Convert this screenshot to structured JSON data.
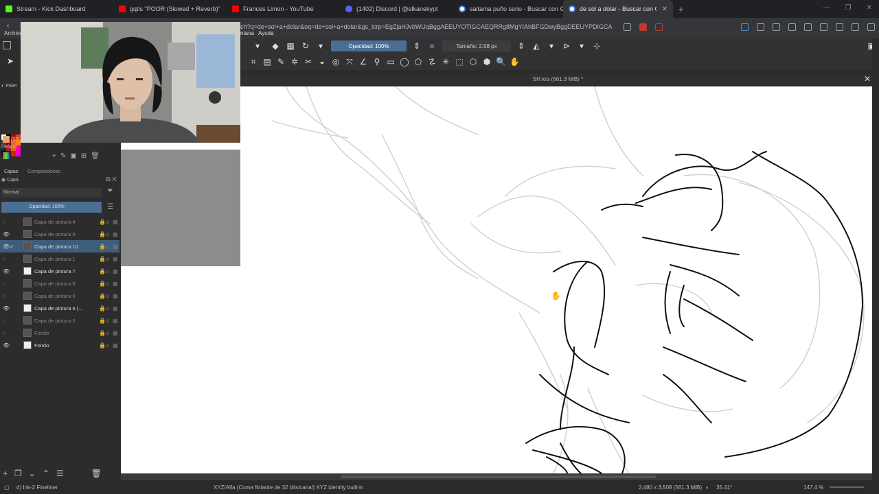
{
  "browser": {
    "tabs": [
      {
        "title": "Stream - Kick Dashboard",
        "color": "#53fc18"
      },
      {
        "title": "gqtis \"POOR (Slowed + Reverb)\"",
        "color": "#ff0000"
      },
      {
        "title": "Frances Limon - YouTube",
        "color": "#ff0000"
      },
      {
        "title": "(1402) Discord | @elkanekypt",
        "color": "#5865f2"
      },
      {
        "title": "saitama puño serio - Buscar con Goo",
        "color": "#4285f4"
      },
      {
        "title": "de sol a dolar - Buscar con Goog",
        "color": "#4285f4"
      }
    ],
    "new_tab": "+",
    "url": "ch?q=de+sol+a+dolar&oq=de+sol+a+dolar&gs_lcrp=EgZjaHJvbWUqBggAEEUYOTIGCAEQRRg8MgYIAhBFGDwyBggDEEUYPDIGCA",
    "back": "‹"
  },
  "krita": {
    "menu": [
      "ntana",
      "Ayuda"
    ],
    "left_menu_text": "Archivo",
    "opacity_label": "Opacidad: 100%",
    "size_label": "Tamaño: 2.58 px",
    "document_title": "SH.kra (561.3 MiB) *",
    "close": "✕"
  },
  "left_panel": {
    "paleta": "Palet",
    "default_label": "Default",
    "april_label": "Apri",
    "tabs": [
      "Capas",
      "Composiciones"
    ],
    "capas_header": "Capa",
    "blend_mode": "Normal",
    "opacity": "Opacidad: 100%",
    "layers": [
      {
        "name": "Capa de pintura 4",
        "visible": false,
        "bright": false,
        "thumb": "dark",
        "active": false
      },
      {
        "name": "Capa de pintura 9",
        "visible": true,
        "bright": false,
        "thumb": "dark",
        "active": false
      },
      {
        "name": "Capa de pintura 10",
        "visible": true,
        "bright": false,
        "thumb": "dark",
        "active": true
      },
      {
        "name": "Capa de pintura 1",
        "visible": false,
        "bright": false,
        "thumb": "dark",
        "active": false
      },
      {
        "name": "Capa de pintura 7",
        "visible": true,
        "bright": true,
        "thumb": "white",
        "active": false
      },
      {
        "name": "Capa de pintura 8",
        "visible": false,
        "bright": false,
        "thumb": "dark",
        "active": false
      },
      {
        "name": "Capa de pintura 6",
        "visible": false,
        "bright": false,
        "thumb": "dark",
        "active": false
      },
      {
        "name": "Capa de pintura 6 (...",
        "visible": true,
        "bright": true,
        "thumb": "white",
        "active": false
      },
      {
        "name": "Capa de pintura 5",
        "visible": false,
        "bright": false,
        "thumb": "dark",
        "active": false
      },
      {
        "name": "Fondo",
        "visible": false,
        "bright": false,
        "thumb": "dark",
        "active": false
      },
      {
        "name": "Fondo",
        "visible": true,
        "bright": true,
        "thumb": "white",
        "active": false
      }
    ]
  },
  "statusbar": {
    "brush": "d) Ink-2 Fineliner",
    "colorspace": "XYZ/Alfa (Coma flotante de 32 bits/canal)  XYZ identity built-in",
    "dimensions": "2,480 x 3,508 (561.3 MiB)",
    "rotation": "35.41°",
    "zoom": "147.4 %"
  }
}
